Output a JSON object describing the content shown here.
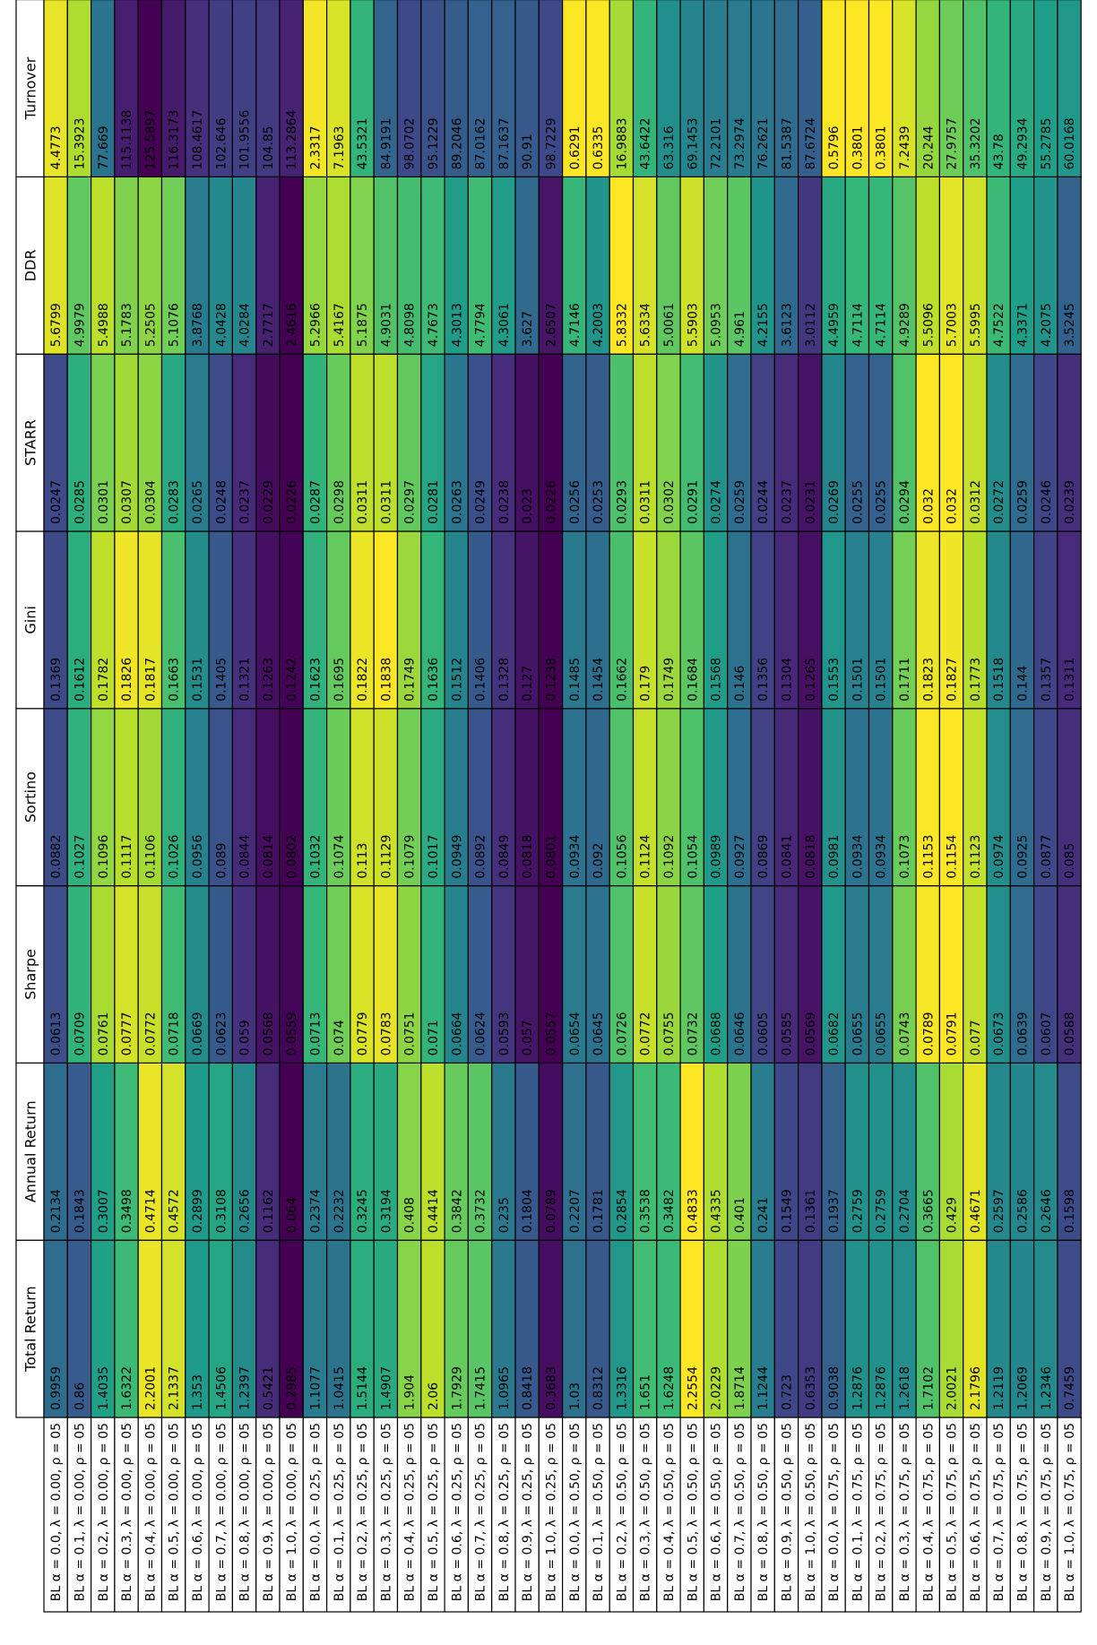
{
  "chart_data": {
    "type": "heatmap",
    "title": "",
    "columns": [
      "Total Return",
      "Annual Return",
      "Sharpe",
      "Sortino",
      "Gini",
      "STARR",
      "DDR",
      "Turnover"
    ],
    "rows": [
      "BL α = 0.0, λ = 0.00, ρ = 05",
      "BL α = 0.1, λ = 0.00, ρ = 05",
      "BL α = 0.2, λ = 0.00, ρ = 05",
      "BL α = 0.3, λ = 0.00, ρ = 05",
      "BL α = 0.4, λ = 0.00, ρ = 05",
      "BL α = 0.5, λ = 0.00, ρ = 05",
      "BL α = 0.6, λ = 0.00, ρ = 05",
      "BL α = 0.7, λ = 0.00, ρ = 05",
      "BL α = 0.8, λ = 0.00, ρ = 05",
      "BL α = 0.9, λ = 0.00, ρ = 05",
      "BL α = 1.0, λ = 0.00, ρ = 05",
      "BL α = 0.0, λ = 0.25, ρ = 05",
      "BL α = 0.1, λ = 0.25, ρ = 05",
      "BL α = 0.2, λ = 0.25, ρ = 05",
      "BL α = 0.3, λ = 0.25, ρ = 05",
      "BL α = 0.4, λ = 0.25, ρ = 05",
      "BL α = 0.5, λ = 0.25, ρ = 05",
      "BL α = 0.6, λ = 0.25, ρ = 05",
      "BL α = 0.7, λ = 0.25, ρ = 05",
      "BL α = 0.8, λ = 0.25, ρ = 05",
      "BL α = 0.9, λ = 0.25, ρ = 05",
      "BL α = 1.0, λ = 0.25, ρ = 05",
      "BL α = 0.0, λ = 0.50, ρ = 05",
      "BL α = 0.1, λ = 0.50, ρ = 05",
      "BL α = 0.2, λ = 0.50, ρ = 05",
      "BL α = 0.3, λ = 0.50, ρ = 05",
      "BL α = 0.4, λ = 0.50, ρ = 05",
      "BL α = 0.5, λ = 0.50, ρ = 05",
      "BL α = 0.6, λ = 0.50, ρ = 05",
      "BL α = 0.7, λ = 0.50, ρ = 05",
      "BL α = 0.8, λ = 0.50, ρ = 05",
      "BL α = 0.9, λ = 0.50, ρ = 05",
      "BL α = 1.0, λ = 0.50, ρ = 05",
      "BL α = 0.0, λ = 0.75, ρ = 05",
      "BL α = 0.1, λ = 0.75, ρ = 05",
      "BL α = 0.2, λ = 0.75, ρ = 05",
      "BL α = 0.3, λ = 0.75, ρ = 05",
      "BL α = 0.4, λ = 0.75, ρ = 05",
      "BL α = 0.5, λ = 0.75, ρ = 05",
      "BL α = 0.6, λ = 0.75, ρ = 05",
      "BL α = 0.7, λ = 0.75, ρ = 05",
      "BL α = 0.8, λ = 0.75, ρ = 05",
      "BL α = 0.9, λ = 0.75, ρ = 05",
      "BL α = 1.0, λ = 0.75, ρ = 05"
    ],
    "values": [
      [
        "0.9959",
        "0.2134",
        "0.0613",
        "0.0882",
        "0.1369",
        "0.0247",
        "5.6799",
        "4.4773"
      ],
      [
        "0.86",
        "0.1843",
        "0.0709",
        "0.1027",
        "0.1612",
        "0.0285",
        "4.9979",
        "15.3923"
      ],
      [
        "1.4035",
        "0.3007",
        "0.0761",
        "0.1096",
        "0.1782",
        "0.0301",
        "5.4988",
        "77.669"
      ],
      [
        "1.6322",
        "0.3498",
        "0.0777",
        "0.1117",
        "0.1826",
        "0.0307",
        "5.1783",
        "115.1138"
      ],
      [
        "2.2001",
        "0.4714",
        "0.0772",
        "0.1106",
        "0.1817",
        "0.0304",
        "5.2505",
        "125.5897"
      ],
      [
        "2.1337",
        "0.4572",
        "0.0718",
        "0.1026",
        "0.1663",
        "0.0283",
        "5.1076",
        "116.3173"
      ],
      [
        "1.353",
        "0.2899",
        "0.0669",
        "0.0956",
        "0.1531",
        "0.0265",
        "3.8768",
        "108.4617"
      ],
      [
        "1.4506",
        "0.3108",
        "0.0623",
        "0.089",
        "0.1405",
        "0.0248",
        "4.0428",
        "102.646"
      ],
      [
        "1.2397",
        "0.2656",
        "0.059",
        "0.0844",
        "0.1321",
        "0.0237",
        "4.0284",
        "101.9556"
      ],
      [
        "0.5421",
        "0.1162",
        "0.0568",
        "0.0814",
        "0.1263",
        "0.0229",
        "2.7717",
        "104.85"
      ],
      [
        "0.2985",
        "0.064",
        "0.0559",
        "0.0802",
        "0.1242",
        "0.0226",
        "2.4616",
        "113.2864"
      ],
      [
        "1.1077",
        "0.2374",
        "0.0713",
        "0.1032",
        "0.1623",
        "0.0287",
        "5.2966",
        "2.3317"
      ],
      [
        "1.0415",
        "0.2232",
        "0.074",
        "0.1074",
        "0.1695",
        "0.0298",
        "5.4167",
        "7.1963"
      ],
      [
        "1.5144",
        "0.3245",
        "0.0779",
        "0.113",
        "0.1822",
        "0.0311",
        "5.1875",
        "43.5321"
      ],
      [
        "1.4907",
        "0.3194",
        "0.0783",
        "0.1129",
        "0.1838",
        "0.0311",
        "4.9031",
        "84.9191"
      ],
      [
        "1.904",
        "0.408",
        "0.0751",
        "0.1079",
        "0.1749",
        "0.0297",
        "4.8098",
        "98.0702"
      ],
      [
        "2.06",
        "0.4414",
        "0.071",
        "0.1017",
        "0.1636",
        "0.0281",
        "4.7673",
        "95.1229"
      ],
      [
        "1.7929",
        "0.3842",
        "0.0664",
        "0.0949",
        "0.1512",
        "0.0263",
        "4.3013",
        "89.2046"
      ],
      [
        "1.7415",
        "0.3732",
        "0.0624",
        "0.0892",
        "0.1406",
        "0.0249",
        "4.7794",
        "87.0162"
      ],
      [
        "1.0965",
        "0.235",
        "0.0593",
        "0.0849",
        "0.1328",
        "0.0238",
        "4.3061",
        "87.1637"
      ],
      [
        "0.8418",
        "0.1804",
        "0.057",
        "0.0818",
        "0.127",
        "0.023",
        "3.627",
        "90.91"
      ],
      [
        "0.3683",
        "0.0789",
        "0.0557",
        "0.0801",
        "0.1238",
        "0.0226",
        "2.6507",
        "98.7229"
      ],
      [
        "1.03",
        "0.2207",
        "0.0654",
        "0.0934",
        "0.1485",
        "0.0256",
        "4.7146",
        "0.6291"
      ],
      [
        "0.8312",
        "0.1781",
        "0.0645",
        "0.092",
        "0.1454",
        "0.0253",
        "4.2003",
        "0.6335"
      ],
      [
        "1.3316",
        "0.2854",
        "0.0726",
        "0.1056",
        "0.1662",
        "0.0293",
        "5.8332",
        "16.9883"
      ],
      [
        "1.651",
        "0.3538",
        "0.0772",
        "0.1124",
        "0.179",
        "0.0311",
        "5.6334",
        "43.6422"
      ],
      [
        "1.6248",
        "0.3482",
        "0.0755",
        "0.1092",
        "0.1749",
        "0.0302",
        "5.0061",
        "63.316"
      ],
      [
        "2.2554",
        "0.4833",
        "0.0732",
        "0.1054",
        "0.1684",
        "0.0291",
        "5.5903",
        "69.1453"
      ],
      [
        "2.0229",
        "0.4335",
        "0.0688",
        "0.0989",
        "0.1568",
        "0.0274",
        "5.0953",
        "72.2101"
      ],
      [
        "1.8714",
        "0.401",
        "0.0646",
        "0.0927",
        "0.146",
        "0.0259",
        "4.961",
        "73.2974"
      ],
      [
        "1.1244",
        "0.241",
        "0.0605",
        "0.0869",
        "0.1356",
        "0.0244",
        "4.2155",
        "76.2621"
      ],
      [
        "0.723",
        "0.1549",
        "0.0585",
        "0.0841",
        "0.1304",
        "0.0237",
        "3.6123",
        "81.5387"
      ],
      [
        "0.6353",
        "0.1361",
        "0.0569",
        "0.0818",
        "0.1265",
        "0.0231",
        "3.0112",
        "87.6724"
      ],
      [
        "0.9038",
        "0.1937",
        "0.0682",
        "0.0981",
        "0.1553",
        "0.0269",
        "4.4959",
        "0.5796"
      ],
      [
        "1.2876",
        "0.2759",
        "0.0655",
        "0.0934",
        "0.1501",
        "0.0255",
        "4.7114",
        "0.3801"
      ],
      [
        "1.2876",
        "0.2759",
        "0.0655",
        "0.0934",
        "0.1501",
        "0.0255",
        "4.7114",
        "0.3801"
      ],
      [
        "1.2618",
        "0.2704",
        "0.0743",
        "0.1073",
        "0.1711",
        "0.0294",
        "4.9289",
        "7.2439"
      ],
      [
        "1.7102",
        "0.3665",
        "0.0789",
        "0.1153",
        "0.1823",
        "0.032",
        "5.5096",
        "20.244"
      ],
      [
        "2.0021",
        "0.429",
        "0.0791",
        "0.1154",
        "0.1827",
        "0.032",
        "5.7003",
        "27.9757"
      ],
      [
        "2.1796",
        "0.4671",
        "0.077",
        "0.1123",
        "0.1773",
        "0.0312",
        "5.5995",
        "35.3202"
      ],
      [
        "1.2119",
        "0.2597",
        "0.0673",
        "0.0974",
        "0.1518",
        "0.0272",
        "4.7522",
        "43.78"
      ],
      [
        "1.2069",
        "0.2586",
        "0.0639",
        "0.0925",
        "0.144",
        "0.0259",
        "4.3371",
        "49.2934"
      ],
      [
        "1.2346",
        "0.2646",
        "0.0607",
        "0.0877",
        "0.1357",
        "0.0246",
        "4.2075",
        "55.2785"
      ],
      [
        "0.7459",
        "0.1598",
        "0.0588",
        "0.085",
        "0.1311",
        "0.0239",
        "3.5245",
        "60.0168"
      ]
    ],
    "color_scale": "viridis",
    "color_direction": "higher values brighter; Turnover column reversed (lower values brighter)"
  }
}
